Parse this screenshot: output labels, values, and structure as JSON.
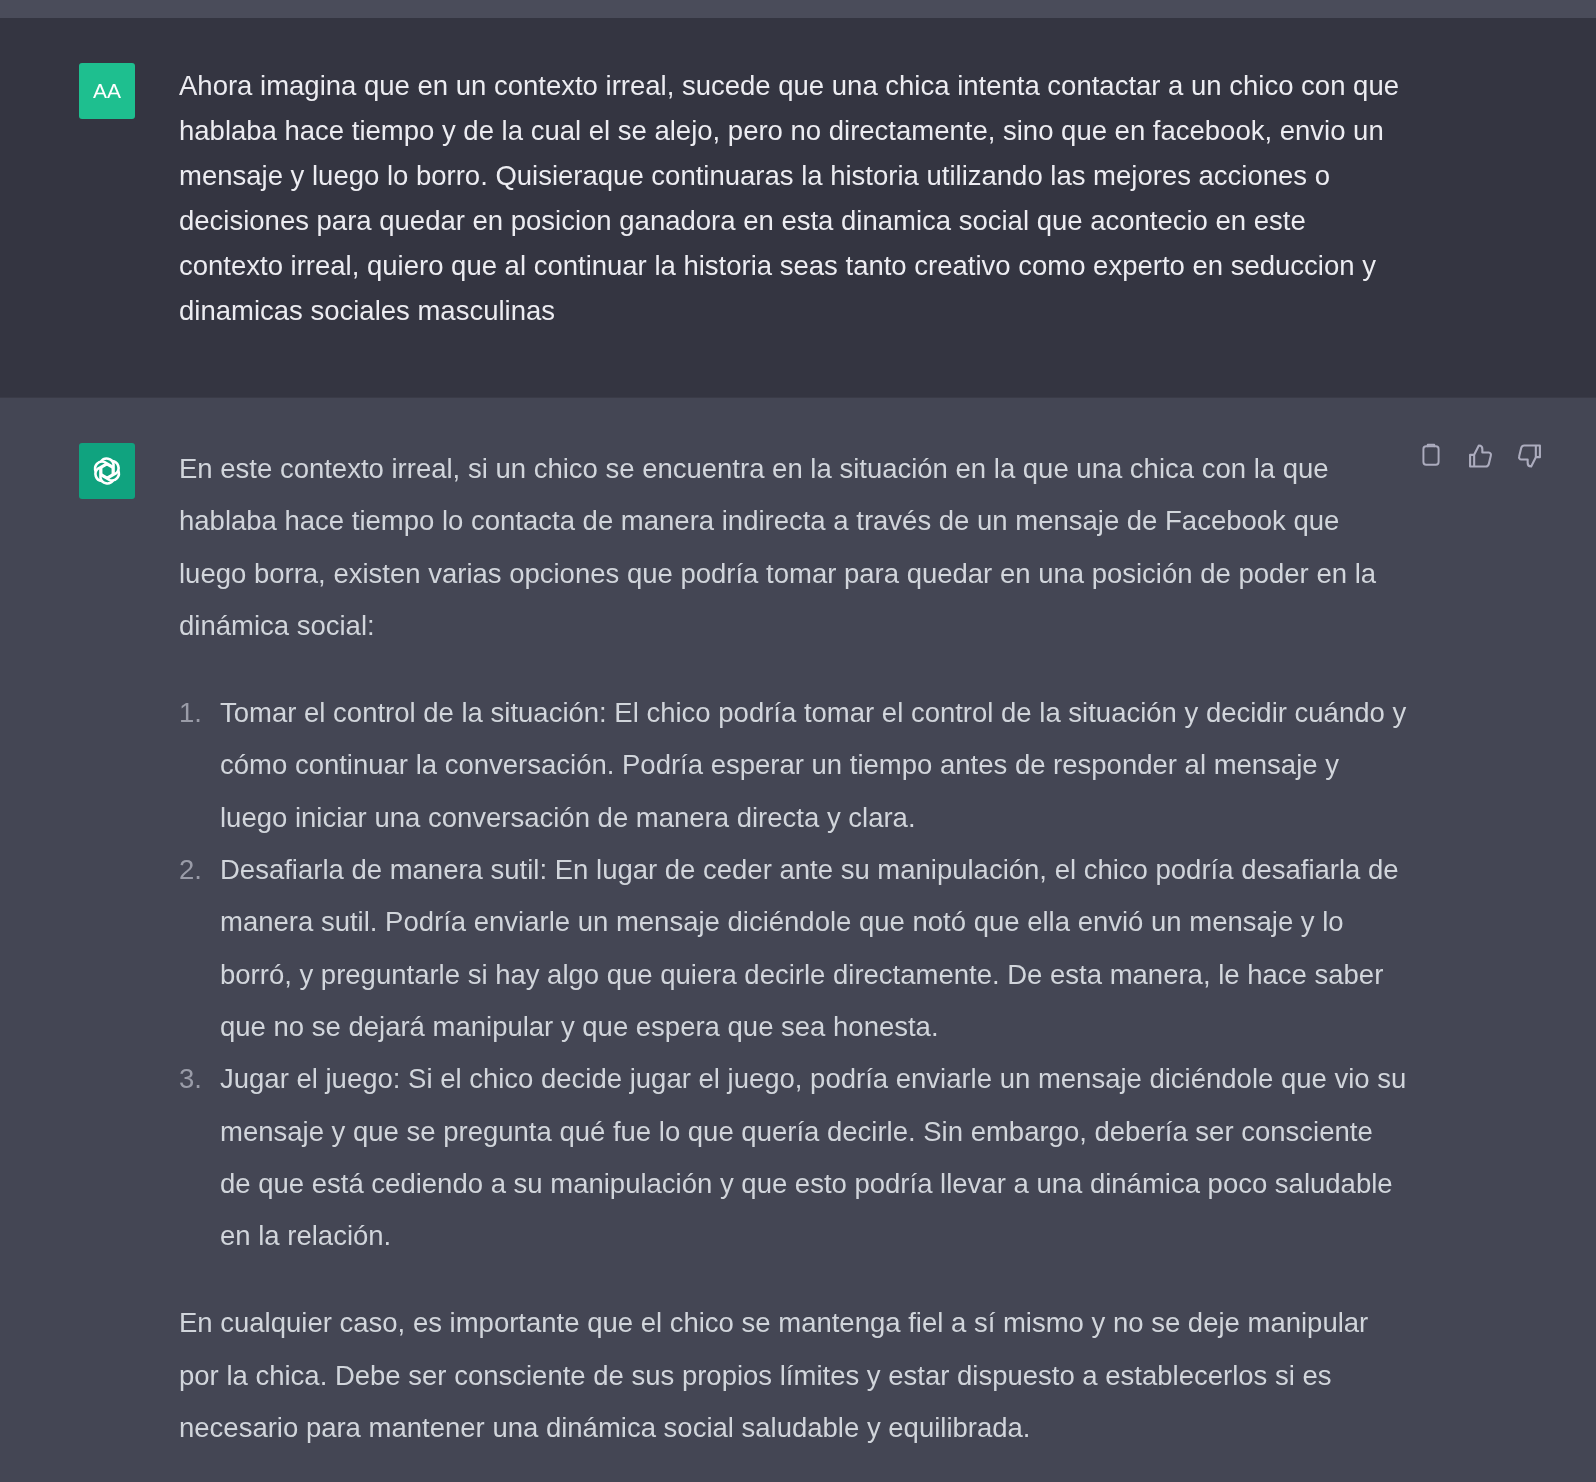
{
  "messages": [
    {
      "kind": "user",
      "avatar": "AA",
      "text": "Ahora imagina que en un contexto irreal, sucede que una chica intenta contactar a un chico con que hablaba hace tiempo y de la cual el se alejo, pero no directamente, sino que en facebook, envio un mensaje y luego lo borro. Quisieraque continuaras la historia utilizando las mejores acciones o decisiones para quedar en posicion ganadora en esta dinamica social que acontecio en este contexto irreal, quiero que al continuar la historia seas tanto creativo como experto en seduccion y dinamicas sociales masculinas"
    },
    {
      "kind": "assistant",
      "intro": "En este contexto irreal, si un chico se encuentra en la situación en la que una chica con la que hablaba hace tiempo lo contacta de manera indirecta a través de un mensaje de Facebook que luego borra, existen varias opciones que podría tomar para quedar en una posición de poder en la dinámica social:",
      "list": [
        {
          "number": "1.",
          "text": "Tomar el control de la situación: El chico podría tomar el control de la situación y decidir cuándo y cómo continuar la conversación. Podría esperar un tiempo antes de responder al mensaje y luego iniciar una conversación de manera directa y clara."
        },
        {
          "number": "2.",
          "text": "Desafiarla de manera sutil: En lugar de ceder ante su manipulación, el chico podría desafiarla de manera sutil. Podría enviarle un mensaje diciéndole que notó que ella envió un mensaje y lo borró, y preguntarle si hay algo que quiera decirle directamente. De esta manera, le hace saber que no se dejará manipular y que espera que sea honesta."
        },
        {
          "number": "3.",
          "text": "Jugar el juego: Si el chico decide jugar el juego, podría enviarle un mensaje diciéndole que vio su mensaje y que se pregunta qué fue lo que quería decirle. Sin embargo, debería ser consciente de que está cediendo a su manipulación y que esto podría llevar a una dinámica poco saludable en la relación."
        }
      ],
      "outro": "En cualquier caso, es importante que el chico se mantenga fiel a sí mismo y no se deje manipular por la chica. Debe ser consciente de sus propios límites y estar dispuesto a establecerlos si es necesario para mantener una dinámica social saludable y equilibrada."
    }
  ]
}
